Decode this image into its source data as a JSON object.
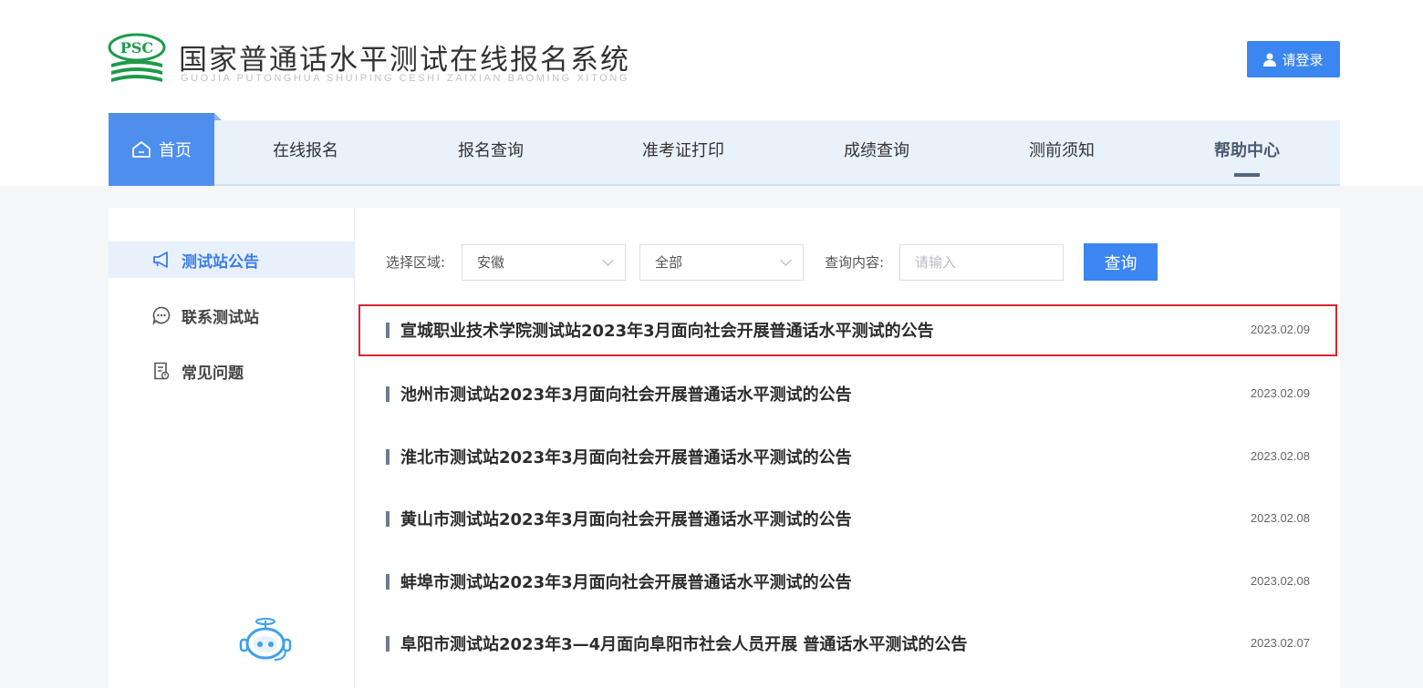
{
  "header": {
    "logo_mark_text": "PSC",
    "title": "国家普通话水平测试在线报名系统",
    "subtitle": "GUOJIA PUTONGHUA SHUIPING CESHI ZAIXIAN BAOMING XITONG",
    "login_label": "请登录"
  },
  "nav": {
    "home_label": "首页",
    "items": [
      {
        "label": "在线报名"
      },
      {
        "label": "报名查询"
      },
      {
        "label": "准考证打印"
      },
      {
        "label": "成绩查询"
      },
      {
        "label": "测前须知"
      },
      {
        "label": "帮助中心"
      }
    ],
    "active": "帮助中心"
  },
  "sidebar": {
    "items": [
      {
        "label": "测试站公告",
        "icon": "megaphone-icon"
      },
      {
        "label": "联系测试站",
        "icon": "chat-icon"
      },
      {
        "label": "常见问题",
        "icon": "document-question-icon"
      }
    ],
    "active": "测试站公告"
  },
  "filter": {
    "region_label": "选择区域:",
    "region_value": "安徽",
    "category_value": "全部",
    "query_label": "查询内容:",
    "query_placeholder": "请输入",
    "query_button": "查询"
  },
  "notices": [
    {
      "title": "宣城职业技术学院测试站2023年3月面向社会开展普通话水平测试的公告",
      "date": "2023.02.09"
    },
    {
      "title": "池州市测试站2023年3月面向社会开展普通话水平测试的公告",
      "date": "2023.02.09"
    },
    {
      "title": "淮北市测试站2023年3月面向社会开展普通话水平测试的公告",
      "date": "2023.02.08"
    },
    {
      "title": "黄山市测试站2023年3月面向社会开展普通话水平测试的公告",
      "date": "2023.02.08"
    },
    {
      "title": "蚌埠市测试站2023年3月面向社会开展普通话水平测试的公告",
      "date": "2023.02.08"
    },
    {
      "title": "阜阳市测试站2023年3—4月面向阜阳市社会人员开展 普通话水平测试的公告",
      "date": "2023.02.07"
    }
  ],
  "colors": {
    "primary": "#3b86f0",
    "nav_bg": "#e9f1fb",
    "highlight_border": "#d9262c",
    "logo_green": "#1e9a4a"
  }
}
